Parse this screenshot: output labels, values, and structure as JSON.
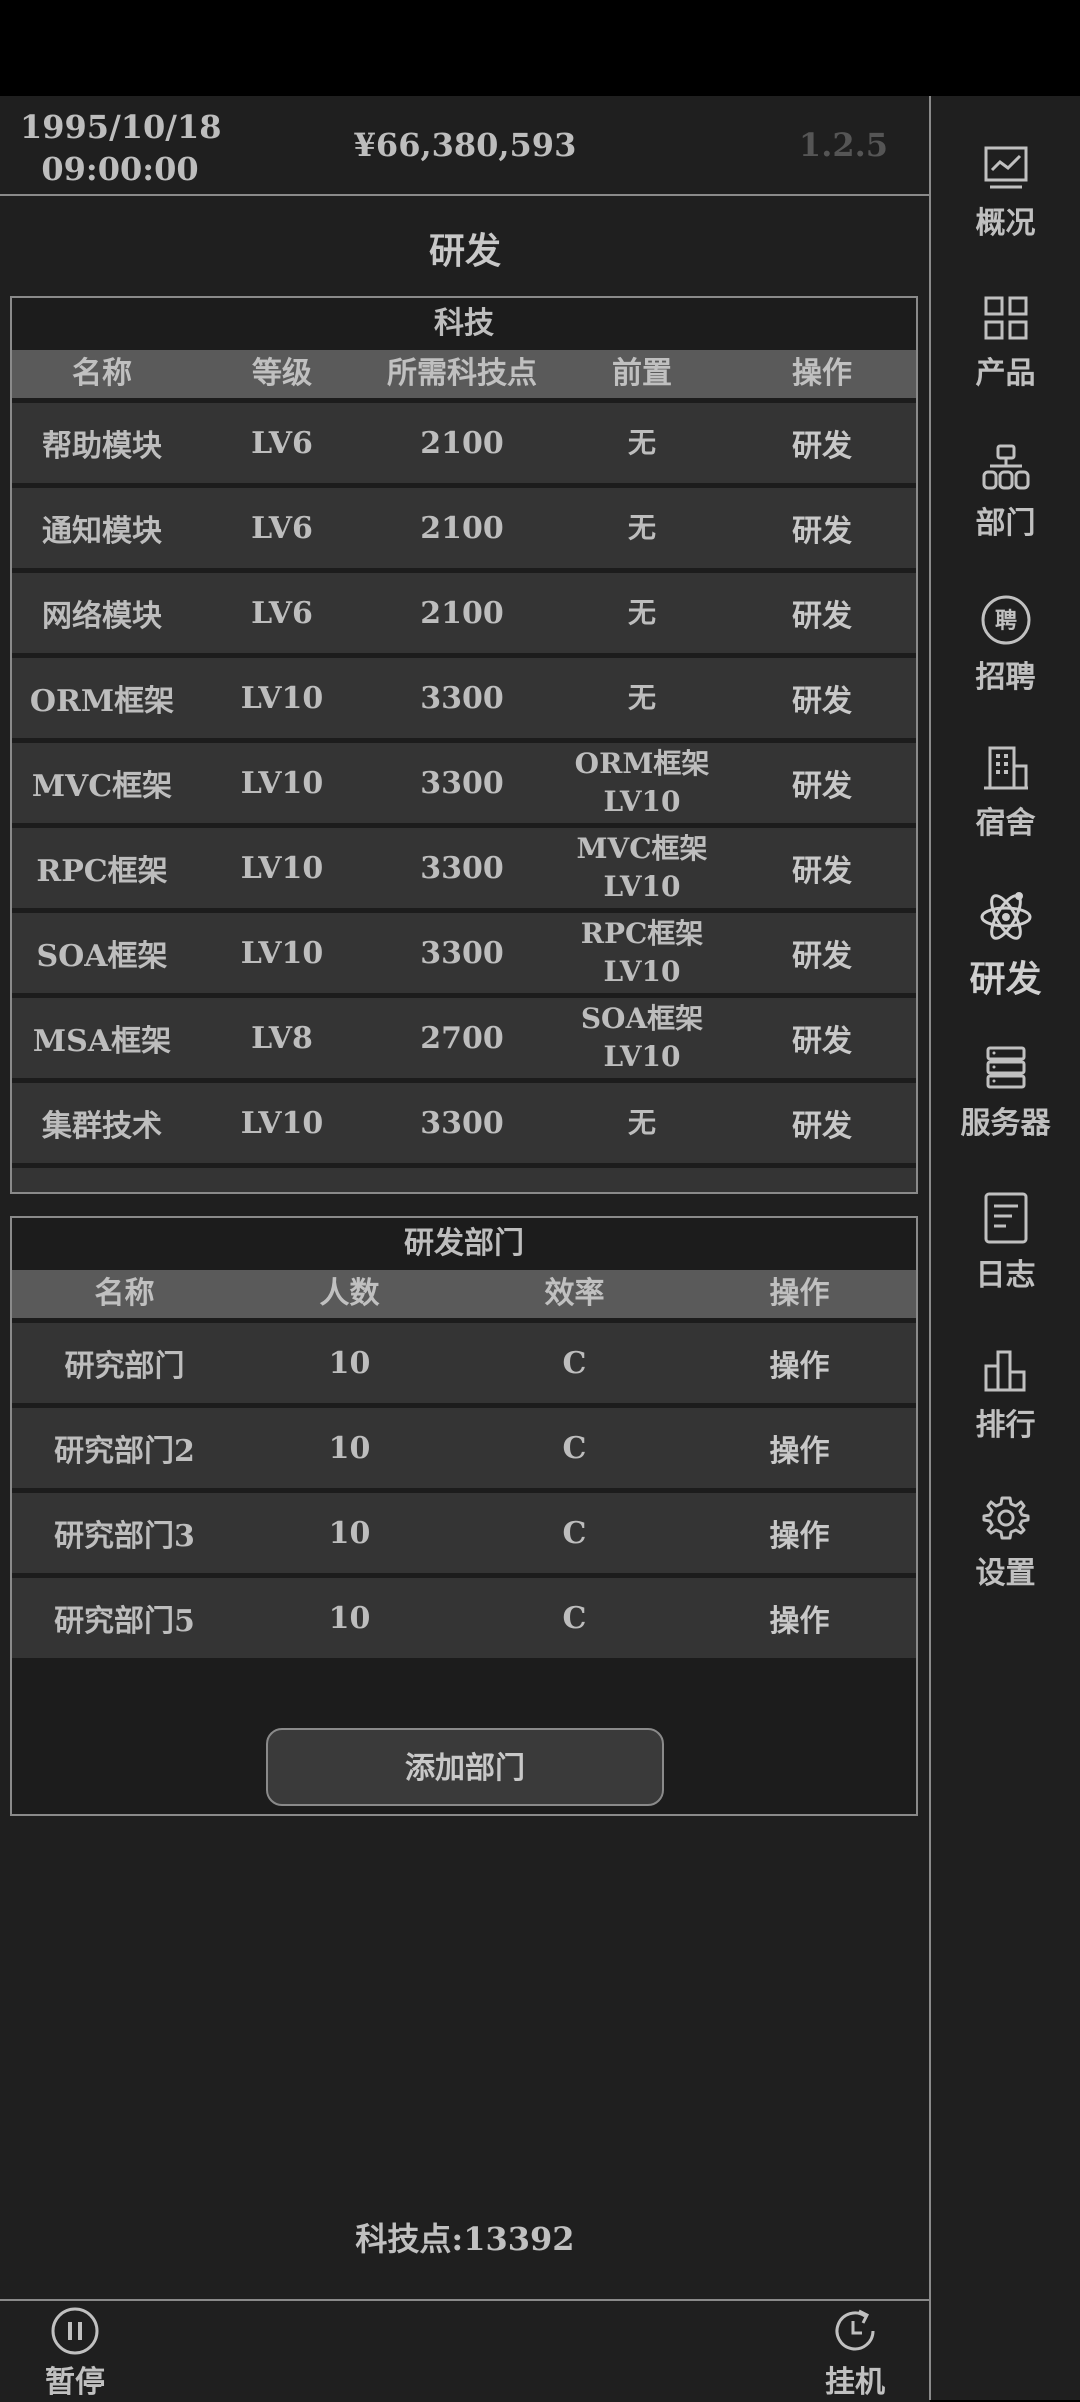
{
  "header": {
    "date": "1995/10/18",
    "time": "09:00:00",
    "money": "¥66,380,593",
    "version": "1.2.5"
  },
  "page_title": "研发",
  "tech_panel": {
    "title": "科技",
    "columns": [
      "名称",
      "等级",
      "所需科技点",
      "前置",
      "操作"
    ],
    "rows": [
      {
        "name": "帮助模块",
        "level": "LV6",
        "points": "2100",
        "pre1": "无",
        "pre2": "",
        "op": "研发"
      },
      {
        "name": "通知模块",
        "level": "LV6",
        "points": "2100",
        "pre1": "无",
        "pre2": "",
        "op": "研发"
      },
      {
        "name": "网络模块",
        "level": "LV6",
        "points": "2100",
        "pre1": "无",
        "pre2": "",
        "op": "研发"
      },
      {
        "name": "ORM框架",
        "level": "LV10",
        "points": "3300",
        "pre1": "无",
        "pre2": "",
        "op": "研发"
      },
      {
        "name": "MVC框架",
        "level": "LV10",
        "points": "3300",
        "pre1": "ORM框架",
        "pre2": "LV10",
        "op": "研发"
      },
      {
        "name": "RPC框架",
        "level": "LV10",
        "points": "3300",
        "pre1": "MVC框架",
        "pre2": "LV10",
        "op": "研发"
      },
      {
        "name": "SOA框架",
        "level": "LV10",
        "points": "3300",
        "pre1": "RPC框架",
        "pre2": "LV10",
        "op": "研发"
      },
      {
        "name": "MSA框架",
        "level": "LV8",
        "points": "2700",
        "pre1": "SOA框架",
        "pre2": "LV10",
        "op": "研发"
      },
      {
        "name": "集群技术",
        "level": "LV10",
        "points": "3300",
        "pre1": "无",
        "pre2": "",
        "op": "研发"
      },
      {
        "name": "",
        "level": "",
        "points": "",
        "pre1": "",
        "pre2": "",
        "op": ""
      }
    ]
  },
  "dept_panel": {
    "title": "研发部门",
    "columns": [
      "名称",
      "人数",
      "效率",
      "操作"
    ],
    "rows": [
      {
        "name": "研究部门",
        "count": "10",
        "eff": "C",
        "op": "操作"
      },
      {
        "name": "研究部门2",
        "count": "10",
        "eff": "C",
        "op": "操作"
      },
      {
        "name": "研究部门3",
        "count": "10",
        "eff": "C",
        "op": "操作"
      },
      {
        "name": "研究部门5",
        "count": "10",
        "eff": "C",
        "op": "操作"
      }
    ],
    "add_button": "添加部门"
  },
  "tech_points": "科技点:13392",
  "bottom": {
    "pause": "暂停",
    "idle": "挂机"
  },
  "nav": {
    "overview": "概况",
    "product": "产品",
    "department": "部门",
    "recruit": "招聘",
    "dorm": "宿舍",
    "research": "研发",
    "server": "服务器",
    "log": "日志",
    "ranking": "排行",
    "settings": "设置"
  },
  "icons": {
    "recruit_glyph": "聘"
  },
  "colors": {
    "background": "#1f1f1f",
    "row": "#343434",
    "header": "#5a5a5a",
    "text": "#bdbdbd"
  }
}
